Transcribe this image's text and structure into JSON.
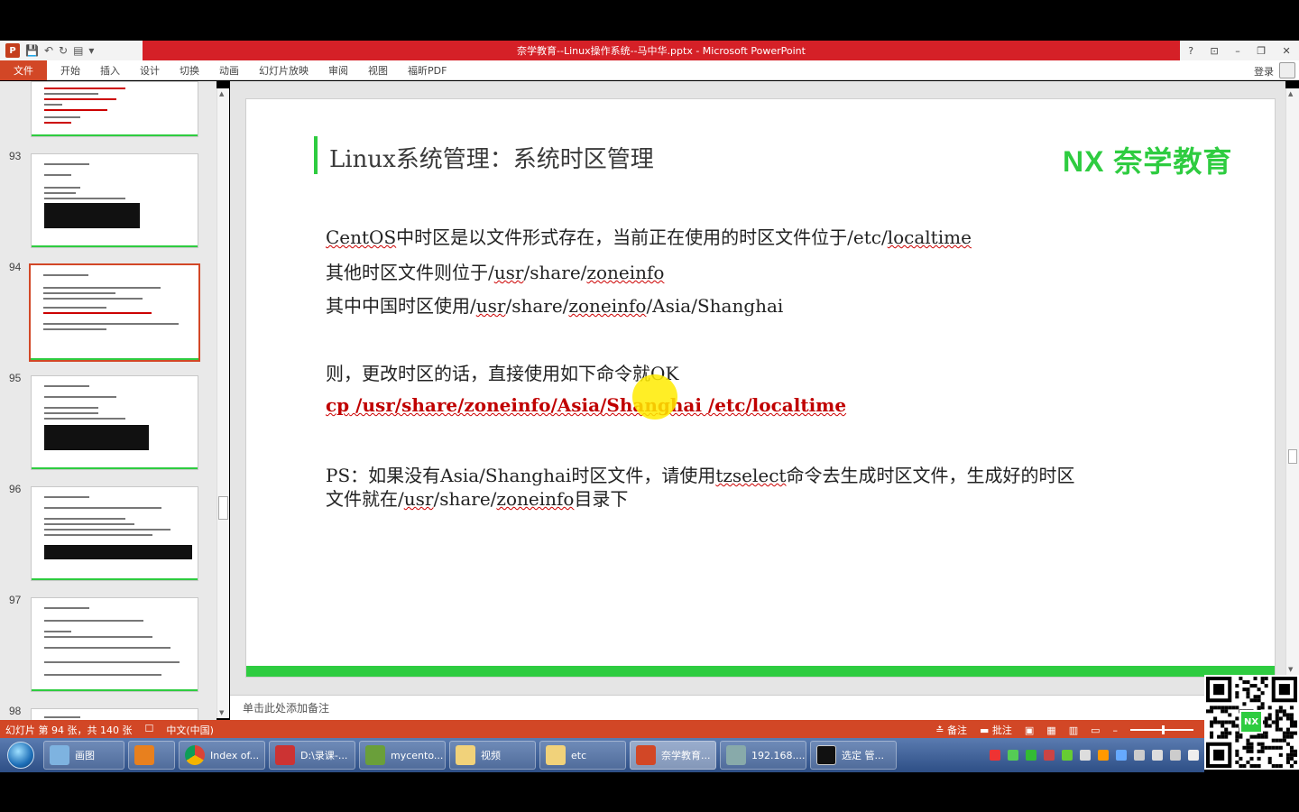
{
  "window": {
    "title": "奈学教育--Linux操作系统--马中华.pptx -  Microsoft PowerPoint",
    "controls": [
      "?",
      "⊡",
      "–",
      "❐",
      "✕"
    ]
  },
  "ribbon": {
    "file_tab": "文件",
    "tabs": [
      "开始",
      "插入",
      "设计",
      "切换",
      "动画",
      "幻灯片放映",
      "审阅",
      "视图",
      "福昕PDF"
    ],
    "login": "登录"
  },
  "thumbnails": {
    "numbers": [
      "93",
      "94",
      "95",
      "96",
      "97",
      "98"
    ],
    "active": "94"
  },
  "slide": {
    "title": "Linux系统管理：系统时区管理",
    "logo": "NX 奈学教育",
    "line1_pre": "CentOS",
    "line1_mid": "中时区是以文件形式存在，当前正在使用的时区文件位于/etc/",
    "line1_end": "localtime",
    "line2_pre": "其他时区文件则位于/",
    "line2_usr": "usr",
    "line2_mid": "/share/",
    "line2_zone": "zoneinfo",
    "line3_pre": "其中中国时区使用/",
    "line3_usr": "usr",
    "line3_mid": "/share/",
    "line3_zone": "zoneinfo",
    "line3_end": "/Asia/Shanghai",
    "line4": "则，更改时区的话，直接使用如下命令就OK",
    "cmd_cp": "cp",
    "cmd_rest": " /usr/share/zoneinfo/Asia/Shanghai  /etc/localtime",
    "ps_line1_pre": "PS：如果没有Asia/Shanghai时区文件，请使用",
    "ps_tz": "tzselect",
    "ps_line1_end": "命令去生成时区文件，生成好的时区",
    "ps_line2_pre": "文件就在/",
    "ps_line2_usr": "usr",
    "ps_line2_mid": "/share/",
    "ps_line2_zone": "zoneinfo",
    "ps_line2_end": "目录下"
  },
  "notes": {
    "placeholder": "单击此处添加备注"
  },
  "statusbar": {
    "slide_info": "幻灯片 第 94 张，共 140 张",
    "spell_icon": "☐",
    "language": "中文(中国)",
    "notes_btn": "备注",
    "comments_btn": "批注"
  },
  "taskbar": {
    "items": [
      "画图",
      "",
      "Index of...",
      "D:\\录课-...",
      "mycento...",
      "视频",
      "etc",
      "奈学教育...",
      "192.168....",
      "选定 管..."
    ]
  },
  "colors": {
    "accent_green": "#2ecc40",
    "ppt_red": "#d24726",
    "title_red": "#d52027",
    "cmd_red": "#c00000"
  }
}
